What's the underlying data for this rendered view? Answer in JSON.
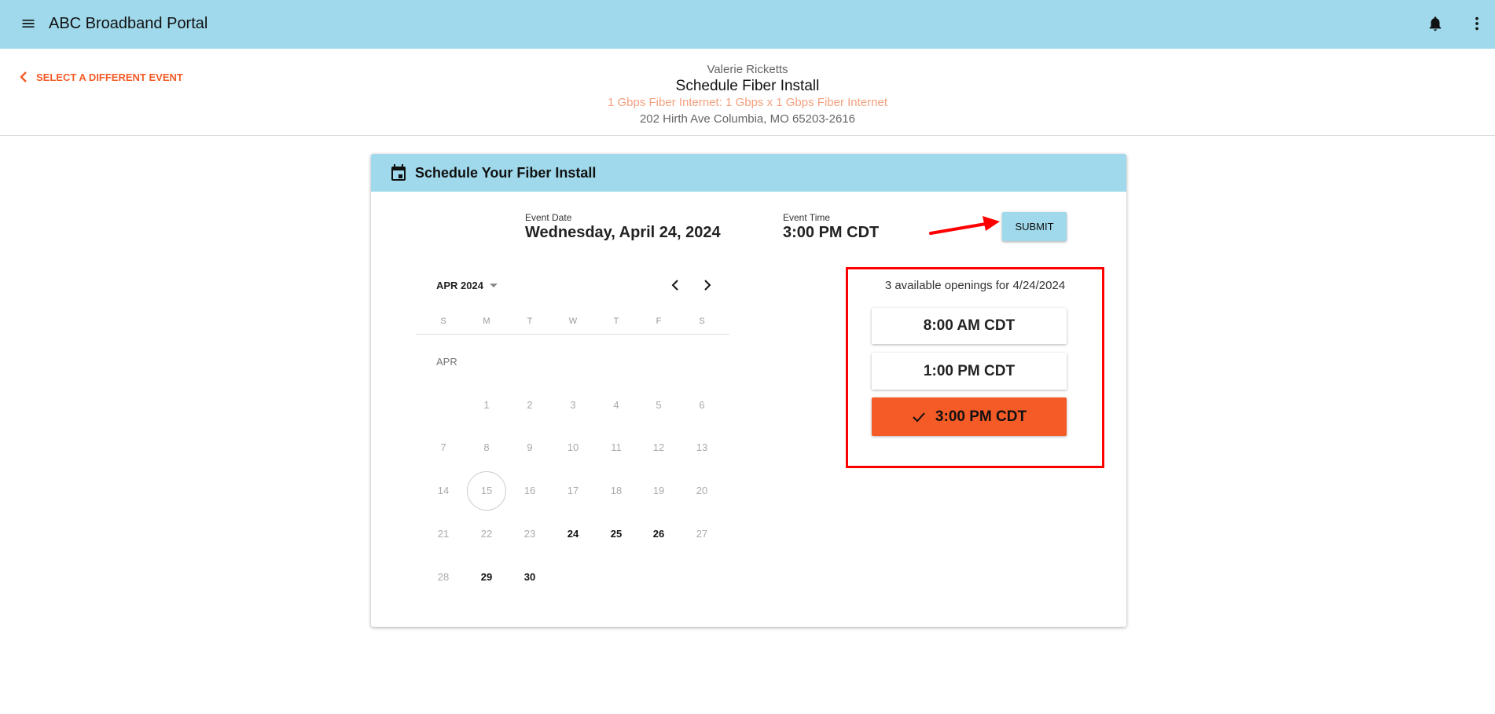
{
  "app": {
    "title": "ABC Broadband Portal",
    "menu_icon": "menu-icon",
    "bell_icon": "bell-icon",
    "more_icon": "more-vert-icon"
  },
  "header": {
    "back_label": "SELECT A DIFFERENT EVENT",
    "customer": "Valerie Ricketts",
    "title": "Schedule Fiber Install",
    "service": "1 Gbps Fiber Internet: 1 Gbps x 1 Gbps Fiber Internet",
    "address": "202 Hirth Ave Columbia, MO 65203-2616"
  },
  "card": {
    "title": "Schedule Your Fiber Install",
    "event_date_label": "Event Date",
    "event_date": "Wednesday, April 24, 2024",
    "event_time_label": "Event Time",
    "event_time": "3:00 PM CDT",
    "submit_label": "SUBMIT"
  },
  "calendar": {
    "month_label": "APR 2024",
    "month_short": "APR",
    "weekdays": [
      "S",
      "M",
      "T",
      "W",
      "T",
      "F",
      "S"
    ],
    "today": 15,
    "selected": 24,
    "available_days": [
      24,
      25,
      26,
      29,
      30
    ],
    "days_in_month": 30,
    "first_weekday": 1
  },
  "openings": {
    "summary": "3 available openings for 4/24/2024",
    "slots": [
      {
        "label": "8:00 AM CDT",
        "selected": false
      },
      {
        "label": "1:00 PM CDT",
        "selected": false
      },
      {
        "label": "3:00 PM CDT",
        "selected": true
      }
    ]
  },
  "colors": {
    "accent": "#f45b27",
    "header": "#9fd9eb",
    "annotation": "#ff0000"
  }
}
